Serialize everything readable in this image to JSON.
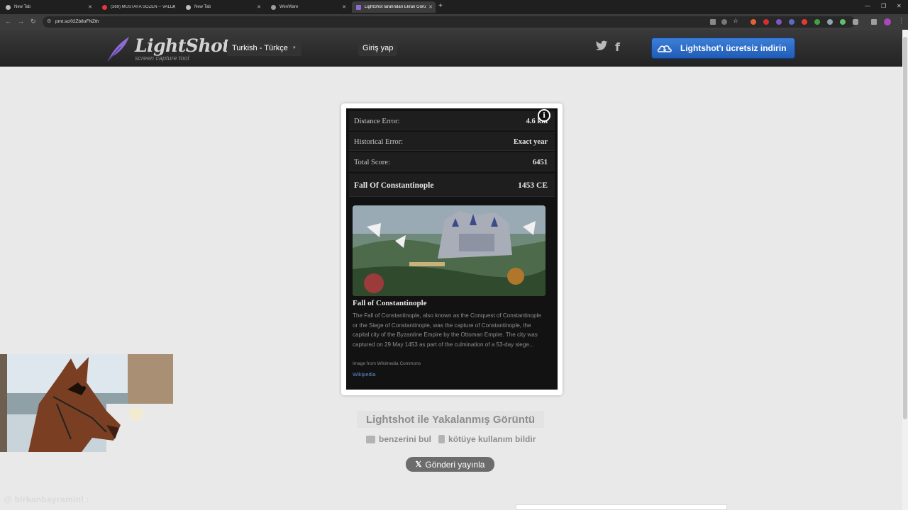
{
  "browser": {
    "tabs": [
      {
        "title": "New Tab",
        "active": false
      },
      {
        "title": "(369) MUSTAFA SÖZEN -- VALLA",
        "active": false
      },
      {
        "title": "New Tab",
        "active": false
      },
      {
        "title": "WenWare",
        "active": false
      },
      {
        "title": "LightShot tarafından Ekran Görüntüsü",
        "active": true
      }
    ],
    "url": "prnt.sc/02Zb8oFNZth"
  },
  "header": {
    "logo_title": "LightShot",
    "logo_subtitle": "screen capture tool",
    "language": "Turkish - Türkçe",
    "login": "Giriş yap",
    "download": "Lightshot'ı ücretsiz indirin"
  },
  "screenshot": {
    "rows": [
      {
        "label": "Distance Error:",
        "value": "4.6 km"
      },
      {
        "label": "Historical Error:",
        "value": "Exact year"
      },
      {
        "label": "Total Score:",
        "value": "6451"
      },
      {
        "label": "Fall Of Constantinople",
        "value": "1453 CE"
      }
    ],
    "wiki": {
      "title": "Fall of Constantinople",
      "description": "The Fall of Constantinople, also known as the Conquest of Constantinople or the Siege of Constantinople, was the capture of Constantinople, the capital city of the Byzantine Empire by the Ottoman Empire. The city was captured on 29 May 1453 as part of the culmination of a 53-day siege...",
      "credit": "Image from Wikimedia Commons",
      "link": "Wikipedia"
    }
  },
  "caption": "Lightshot ile Yakalanmış Görüntü",
  "actions": {
    "similar": "benzerini bul",
    "report": "kötüye kullanım bildir"
  },
  "tweet": "Gönderi yayınla",
  "watermark": "@ birkanbayraminl :"
}
